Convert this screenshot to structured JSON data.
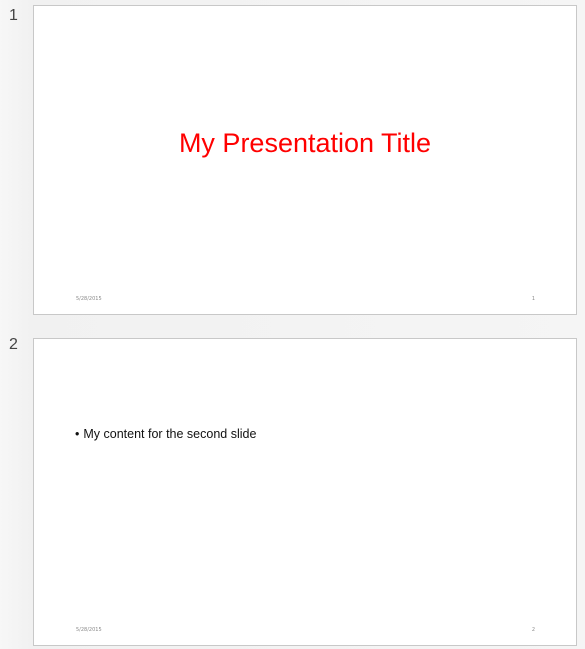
{
  "slides": [
    {
      "number": "1",
      "title": "My Presentation Title",
      "footer_date": "5/28/2015",
      "footer_page": "1",
      "title_color": "#ff0000"
    },
    {
      "number": "2",
      "bullet_marker": "•",
      "bullet_text": "My content for the second slide",
      "footer_date": "5/28/2015",
      "footer_page": "2"
    }
  ]
}
